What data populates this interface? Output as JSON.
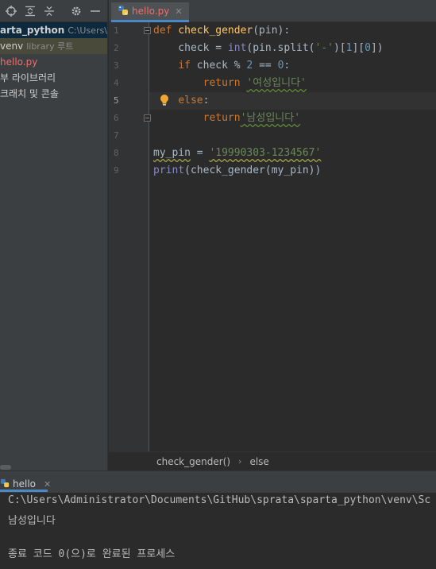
{
  "sidebar": {
    "toolbar_icons": [
      "locate-icon",
      "expand-all-icon",
      "collapse-all-icon",
      "gear-icon",
      "hide-icon"
    ],
    "tree": [
      {
        "label": "arta_python",
        "hint": "C:\\Users\\A",
        "bold": true
      },
      {
        "label": "venv",
        "hint": "library 루트"
      },
      {
        "label": "hello.py",
        "hint": ""
      },
      {
        "label": "부 라이브러리",
        "hint": ""
      },
      {
        "label": "크래치 및 콘솔",
        "hint": ""
      }
    ]
  },
  "tabs": [
    {
      "label": "hello.py",
      "close": "✕"
    }
  ],
  "editor": {
    "line_numbers": [
      "1",
      "2",
      "3",
      "4",
      "5",
      "6",
      "7",
      "8",
      "9"
    ],
    "current_line": "5",
    "lines": [
      [
        {
          "t": "def ",
          "c": "kw"
        },
        {
          "t": "check_gender",
          "c": "fn"
        },
        {
          "t": "(pin):",
          "c": "id"
        }
      ],
      [
        {
          "t": "    check = ",
          "c": "id"
        },
        {
          "t": "int",
          "c": "bi"
        },
        {
          "t": "(pin.split(",
          "c": "id"
        },
        {
          "t": "'-'",
          "c": "str"
        },
        {
          "t": ")[",
          "c": "id"
        },
        {
          "t": "1",
          "c": "num"
        },
        {
          "t": "][",
          "c": "id"
        },
        {
          "t": "0",
          "c": "num"
        },
        {
          "t": "])",
          "c": "id"
        }
      ],
      [
        {
          "t": "    ",
          "c": "id"
        },
        {
          "t": "if ",
          "c": "kw"
        },
        {
          "t": "check % ",
          "c": "id"
        },
        {
          "t": "2",
          "c": "num"
        },
        {
          "t": " == ",
          "c": "id"
        },
        {
          "t": "0",
          "c": "num"
        },
        {
          "t": ":",
          "c": "id"
        }
      ],
      [
        {
          "t": "        ",
          "c": "id"
        },
        {
          "t": "return ",
          "c": "kw"
        },
        {
          "t": "'여성입니다'",
          "c": "str wavy-g"
        }
      ],
      [
        {
          "t": "    ",
          "c": "id"
        },
        {
          "t": "else",
          "c": "kw"
        },
        {
          "t": ":",
          "c": "id"
        }
      ],
      [
        {
          "t": "        ",
          "c": "id"
        },
        {
          "t": "return",
          "c": "kw"
        },
        {
          "t": "'남성입니다'",
          "c": "str wavy-g"
        }
      ],
      [],
      [
        {
          "t": "my_pin",
          "c": "id wavy"
        },
        {
          "t": " = ",
          "c": "id"
        },
        {
          "t": "'19990303-1234567'",
          "c": "str wavy"
        }
      ],
      [
        {
          "t": "print",
          "c": "bi"
        },
        {
          "t": "(check_gender(my_pin))",
          "c": "id"
        }
      ]
    ]
  },
  "breadcrumb": [
    "check_gender()",
    "else"
  ],
  "run": {
    "tab_label": "hello",
    "tab_close": "✕",
    "console_lines": [
      "C:\\Users\\Administrator\\Documents\\GitHub\\sprata\\sparta_python\\venv\\Sc",
      "남성입니다",
      "",
      "종료 코드 0(으)로 완료된 프로세스"
    ]
  },
  "colors": {
    "keyword": "#cc7832",
    "function": "#ffc66d",
    "string": "#6a8759",
    "number": "#6897bb",
    "builtin": "#8888c6",
    "modified_file": "#ef6e6e",
    "accent": "#4a88c7"
  }
}
